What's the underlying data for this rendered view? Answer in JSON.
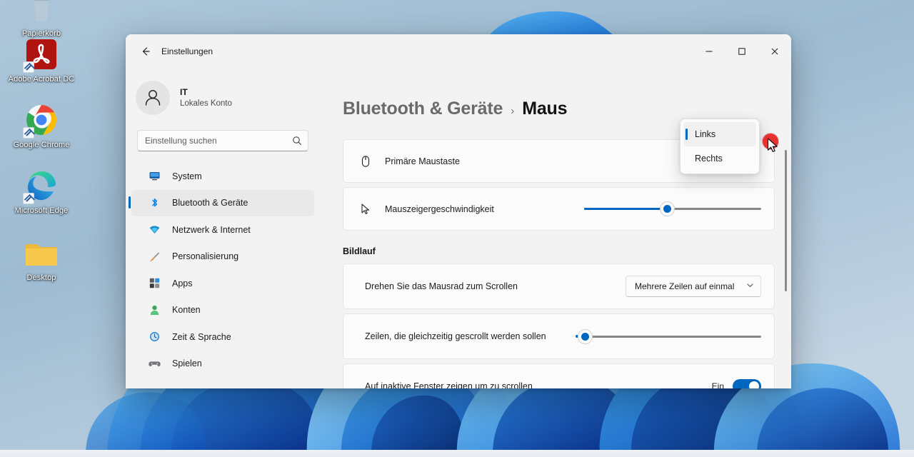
{
  "desktop": {
    "icons": [
      {
        "label": "Papierkorb",
        "icon": "recycle-bin-icon",
        "shortcut": false
      },
      {
        "label": "Adobe Acrobat DC",
        "icon": "adobe-acrobat-icon",
        "shortcut": true
      },
      {
        "label": "Google Chrome",
        "icon": "google-chrome-icon",
        "shortcut": true
      },
      {
        "label": "Microsoft Edge",
        "icon": "microsoft-edge-icon",
        "shortcut": true
      },
      {
        "label": "Desktop",
        "icon": "folder-icon",
        "shortcut": false
      }
    ]
  },
  "window": {
    "title": "Einstellungen",
    "back_icon": "back-arrow-icon",
    "controls": {
      "minimize": "─",
      "maximize": "☐",
      "close": "✕"
    }
  },
  "sidebar": {
    "account": {
      "name": "IT",
      "subtitle": "Lokales Konto",
      "avatar_icon": "person-avatar-icon"
    },
    "search": {
      "placeholder": "Einstellung suchen",
      "value": "",
      "icon": "search-icon"
    },
    "items": [
      {
        "label": "System",
        "icon": "monitor-icon",
        "active": false
      },
      {
        "label": "Bluetooth & Geräte",
        "icon": "bluetooth-icon",
        "active": true
      },
      {
        "label": "Netzwerk & Internet",
        "icon": "network-wifi-icon",
        "active": false
      },
      {
        "label": "Personalisierung",
        "icon": "paintbrush-icon",
        "active": false
      },
      {
        "label": "Apps",
        "icon": "apps-grid-icon",
        "active": false
      },
      {
        "label": "Konten",
        "icon": "account-person-icon",
        "active": false
      },
      {
        "label": "Zeit & Sprache",
        "icon": "clock-icon",
        "active": false
      },
      {
        "label": "Spielen",
        "icon": "gamepad-icon",
        "active": false
      }
    ]
  },
  "main": {
    "breadcrumb": {
      "parent": "Bluetooth & Geräte",
      "separator": "›",
      "current": "Maus"
    },
    "settings": [
      {
        "label": "Primäre Maustaste",
        "icon": "mouse-icon",
        "control": "dropdown-open"
      },
      {
        "label": "Mauszeigergeschwindigkeit",
        "icon": "cursor-arrow-icon",
        "control": "slider",
        "slider_percent": 47
      }
    ],
    "group": {
      "title": "Bildlauf",
      "settings": [
        {
          "label": "Drehen Sie das Mausrad zum Scrollen",
          "control": "combobox",
          "value": "Mehrere Zeilen auf einmal",
          "chevron_icon": "chevron-down-icon"
        },
        {
          "label": "Zeilen, die gleichzeitig gescrollt werden sollen",
          "control": "slider",
          "slider_percent": 4
        },
        {
          "label": "Auf inaktive Fenster zeigen um zu scrollen",
          "control": "toggle",
          "toggle_label": "Ein",
          "toggle_on": true
        }
      ]
    }
  },
  "flyout": {
    "name": "primary-mouse-button-dropdown",
    "options": [
      {
        "label": "Links",
        "selected": true
      },
      {
        "label": "Rechts",
        "selected": false
      }
    ]
  },
  "colors": {
    "accent": "#0067c0",
    "window_bg": "#f3f3f3",
    "card_bg": "#fbfbfb",
    "click_marker": "#e8322d",
    "slider_track": "#868686"
  }
}
